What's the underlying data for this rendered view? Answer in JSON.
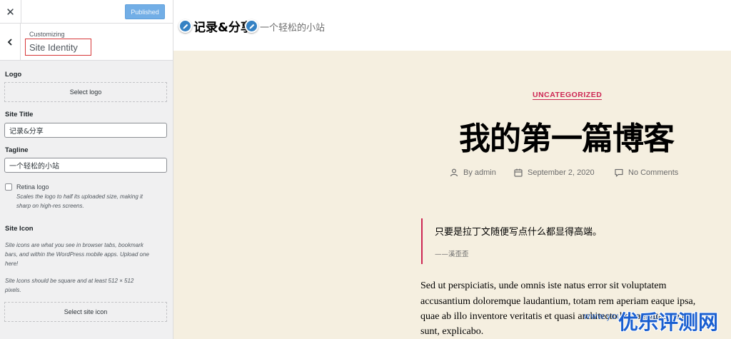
{
  "customizer": {
    "close_icon": "close-icon",
    "publish_label": "Published",
    "customizing_label": "Customizing",
    "section_title": "Site Identity",
    "back_icon": "chevron-left-icon",
    "logo": {
      "label": "Logo",
      "button": "Select logo"
    },
    "site_title": {
      "label": "Site Title",
      "value": "记录&分享"
    },
    "tagline": {
      "label": "Tagline",
      "value": "一个轻松的小站"
    },
    "retina": {
      "label": "Retina logo",
      "checked": false,
      "description_1": "Scales the logo to half its uploaded size, making it",
      "description_2": "sharp on high-res screens."
    },
    "site_icon": {
      "label": "Site Icon",
      "description_1": "Site icons are what you see in browser tabs, bookmark",
      "description_2": "bars, and within the WordPress mobile apps. Upload one",
      "description_3": "here!",
      "requirement_1": "Site Icons should be square and at least 512 × 512",
      "requirement_2": "pixels.",
      "button": "Select site icon"
    }
  },
  "preview": {
    "site_title": "记录&分享",
    "tagline": "一个轻松的小站",
    "category": "UNCATEGORIZED",
    "post_title": "我的第一篇博客",
    "meta": {
      "author_prefix": "By",
      "author": "admin",
      "date": "September 2, 2020",
      "comments": "No Comments"
    },
    "quote": {
      "text": "只要是拉丁文随便写点什么都显得高端。",
      "cite": "——溪歪歪"
    },
    "paragraph_lines": [
      "Sed ut perspiciatis, unde omnis iste natus error sit voluptatem",
      "accusantium doloremque laudantium, totam rem aperiam eaque ipsa,",
      "quae ab illo inventore veritatis et quasi architecto beatae vitae dicta",
      "sunt, explicabo."
    ]
  },
  "watermark": {
    "main": "优乐评测网",
    "sub": "www.youleceping.com"
  },
  "colors": {
    "accent": "#cd2653",
    "publish_button": "#72aee6",
    "edit_shortcut": "#3582c4",
    "highlight_box": "#d63638",
    "preview_bg": "#f5efe0"
  }
}
